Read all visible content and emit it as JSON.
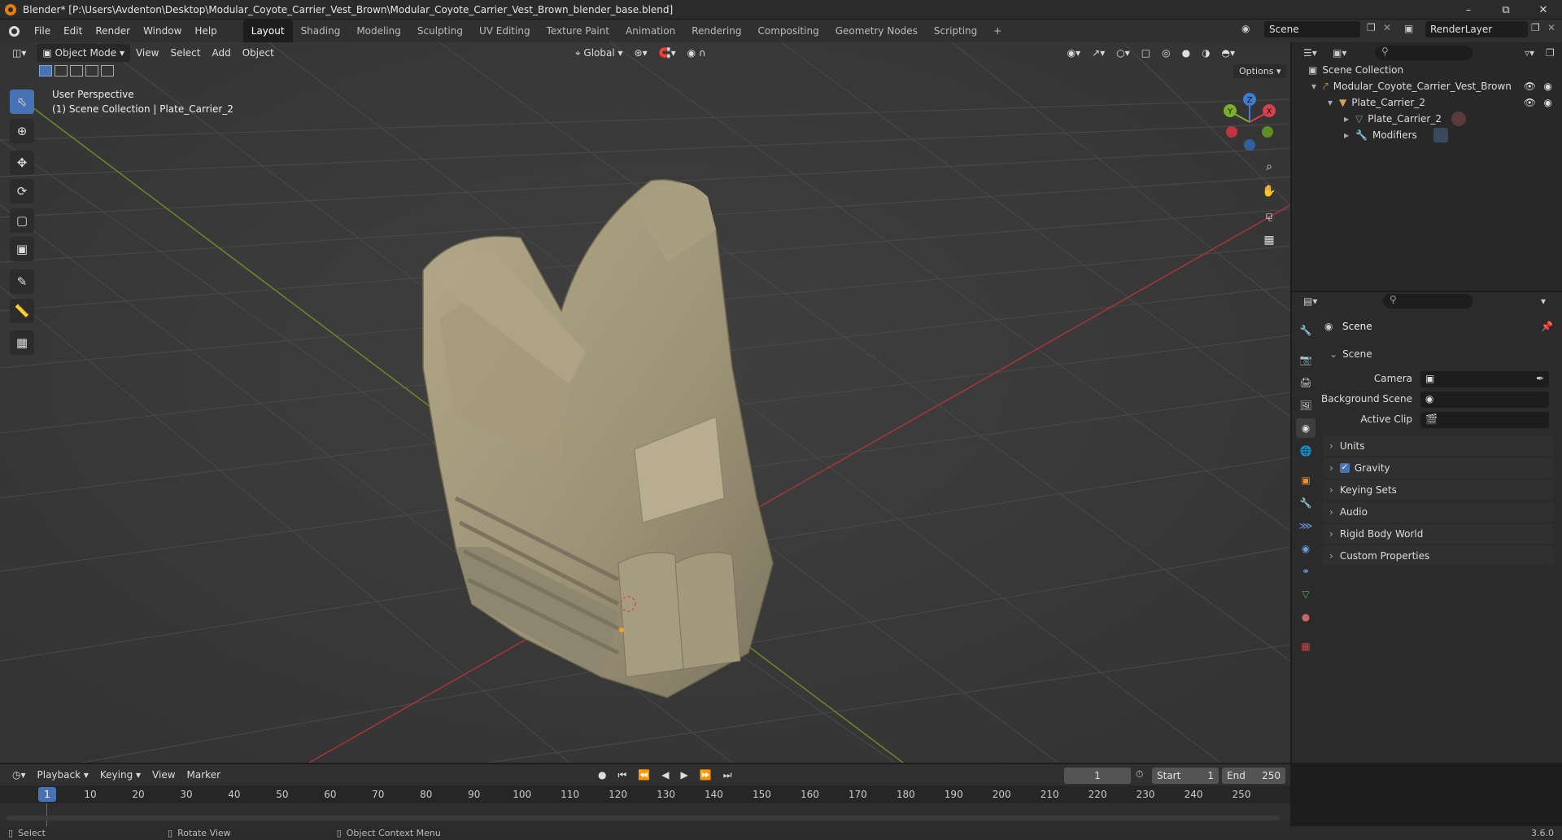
{
  "window": {
    "title": "Blender* [P:\\Users\\Avdenton\\Desktop\\Modular_Coyote_Carrier_Vest_Brown\\Modular_Coyote_Carrier_Vest_Brown_blender_base.blend]"
  },
  "menu": {
    "file": "File",
    "edit": "Edit",
    "render": "Render",
    "window": "Window",
    "help": "Help"
  },
  "workspaces": [
    "Layout",
    "Shading",
    "Modeling",
    "Sculpting",
    "UV Editing",
    "Texture Paint",
    "Animation",
    "Rendering",
    "Compositing",
    "Geometry Nodes",
    "Scripting"
  ],
  "scene_field": "Scene",
  "render_layer_field": "RenderLayer",
  "viewport": {
    "mode": "Object Mode",
    "menus": [
      "View",
      "Select",
      "Add",
      "Object"
    ],
    "transform_orientation": "Global",
    "options": "Options",
    "overlay_line1": "User Perspective",
    "overlay_line2": "(1) Scene Collection | Plate_Carrier_2",
    "gizmo": {
      "x": "X",
      "y": "Y",
      "z": "Z"
    }
  },
  "outliner": {
    "root": "Scene Collection",
    "collection": "Modular_Coyote_Carrier_Vest_Brown",
    "object": "Plate_Carrier_2",
    "mesh": "Plate_Carrier_2",
    "modifiers": "Modifiers"
  },
  "properties": {
    "header": "Scene",
    "section": "Scene",
    "camera_label": "Camera",
    "background_scene_label": "Background Scene",
    "active_clip_label": "Active Clip",
    "panels": [
      "Units",
      "Gravity",
      "Keying Sets",
      "Audio",
      "Rigid Body World",
      "Custom Properties"
    ],
    "gravity_checked": true
  },
  "timeline": {
    "menus": [
      "Playback",
      "Keying",
      "View",
      "Marker"
    ],
    "current_frame": "1",
    "start_label": "Start",
    "start_value": "1",
    "end_label": "End",
    "end_value": "250",
    "ruler": [
      "1",
      "10",
      "20",
      "30",
      "40",
      "50",
      "60",
      "70",
      "80",
      "90",
      "100",
      "110",
      "120",
      "130",
      "140",
      "150",
      "160",
      "170",
      "180",
      "190",
      "200",
      "210",
      "220",
      "230",
      "240",
      "250"
    ]
  },
  "status": {
    "select": "Select",
    "rotate": "Rotate View",
    "context": "Object Context Menu",
    "version": "3.6.0"
  }
}
